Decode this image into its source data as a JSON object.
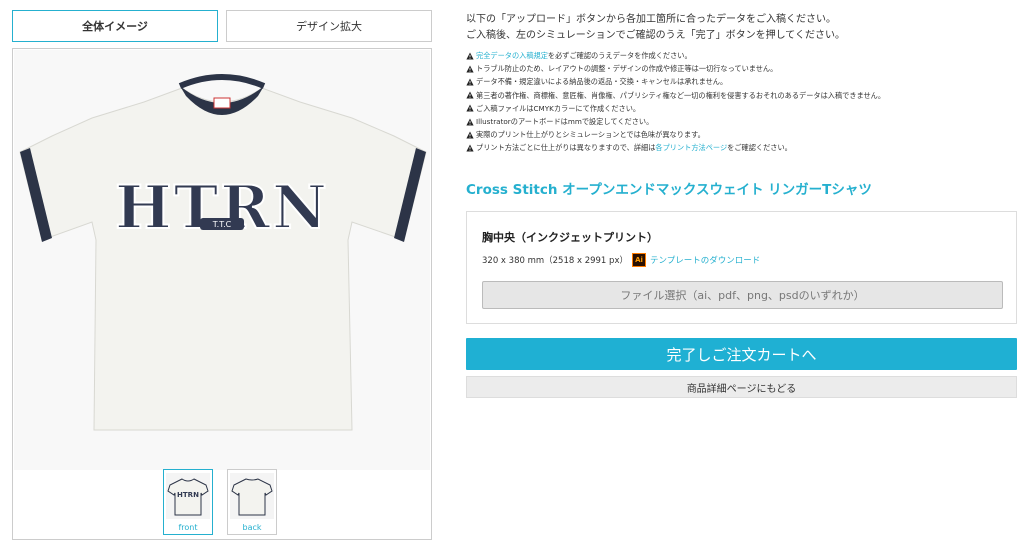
{
  "tabs": [
    {
      "label": "全体イメージ",
      "active": true
    },
    {
      "label": "デザイン拡大",
      "active": false
    }
  ],
  "shirt": {
    "print_text": "HTRN",
    "print_subtext": "T.T.C",
    "body_color": "#f3f3ef",
    "trim_color": "#2c3447"
  },
  "thumbnails": [
    {
      "label": "front",
      "active": true
    },
    {
      "label": "back",
      "active": false
    }
  ],
  "intro": {
    "line1": "以下の「アップロード」ボタンから各加工箇所に合ったデータをご入稿ください。",
    "line2": "ご入稿後、左のシミュレーションでご確認のうえ「完了」ボタンを押してください。"
  },
  "notes": [
    {
      "link": "完全データの入稿規定",
      "text": "を必ずご確認のうえデータを作成ください。"
    },
    {
      "text": "トラブル防止のため、レイアウトの調整・デザインの作成や修正等は一切行なっていません。"
    },
    {
      "text": "データ不備・規定違いによる納品後の返品・交換・キャンセルは承れません。"
    },
    {
      "text": "第三者の著作権、商標権、意匠権、肖像権、パブリシティ権など一切の権利を侵害するおそれのあるデータは入稿できません。"
    },
    {
      "text": "ご入稿ファイルはCMYKカラーにて作成ください。"
    },
    {
      "text": "Illustratorのアートボードはmmで設定してください。"
    },
    {
      "text": "実際のプリント仕上がりとシミュレーションとでは色味が異なります。"
    },
    {
      "text": "プリント方法ごとに仕上がりは異なりますので、詳細は",
      "link": "各プリント方法ページ",
      "suffix": "をご確認ください。"
    }
  ],
  "product": {
    "title": "Cross Stitch オープンエンドマックスウェイト リンガーTシャツ"
  },
  "print_area": {
    "title": "胸中央（インクジェットプリント）",
    "size": "320 x 380 mm（2518 x 2991 px）",
    "ai_label": "Ai",
    "template_link": "テンプレートのダウンロード",
    "file_button": "ファイル選択（ai、pdf、png、psdのいずれか）"
  },
  "buttons": {
    "complete": "完了しご注文カートへ",
    "back": "商品詳細ページにもどる"
  },
  "colors": {
    "accent": "#25b0cf",
    "complete_button": "#1fb0d3"
  }
}
